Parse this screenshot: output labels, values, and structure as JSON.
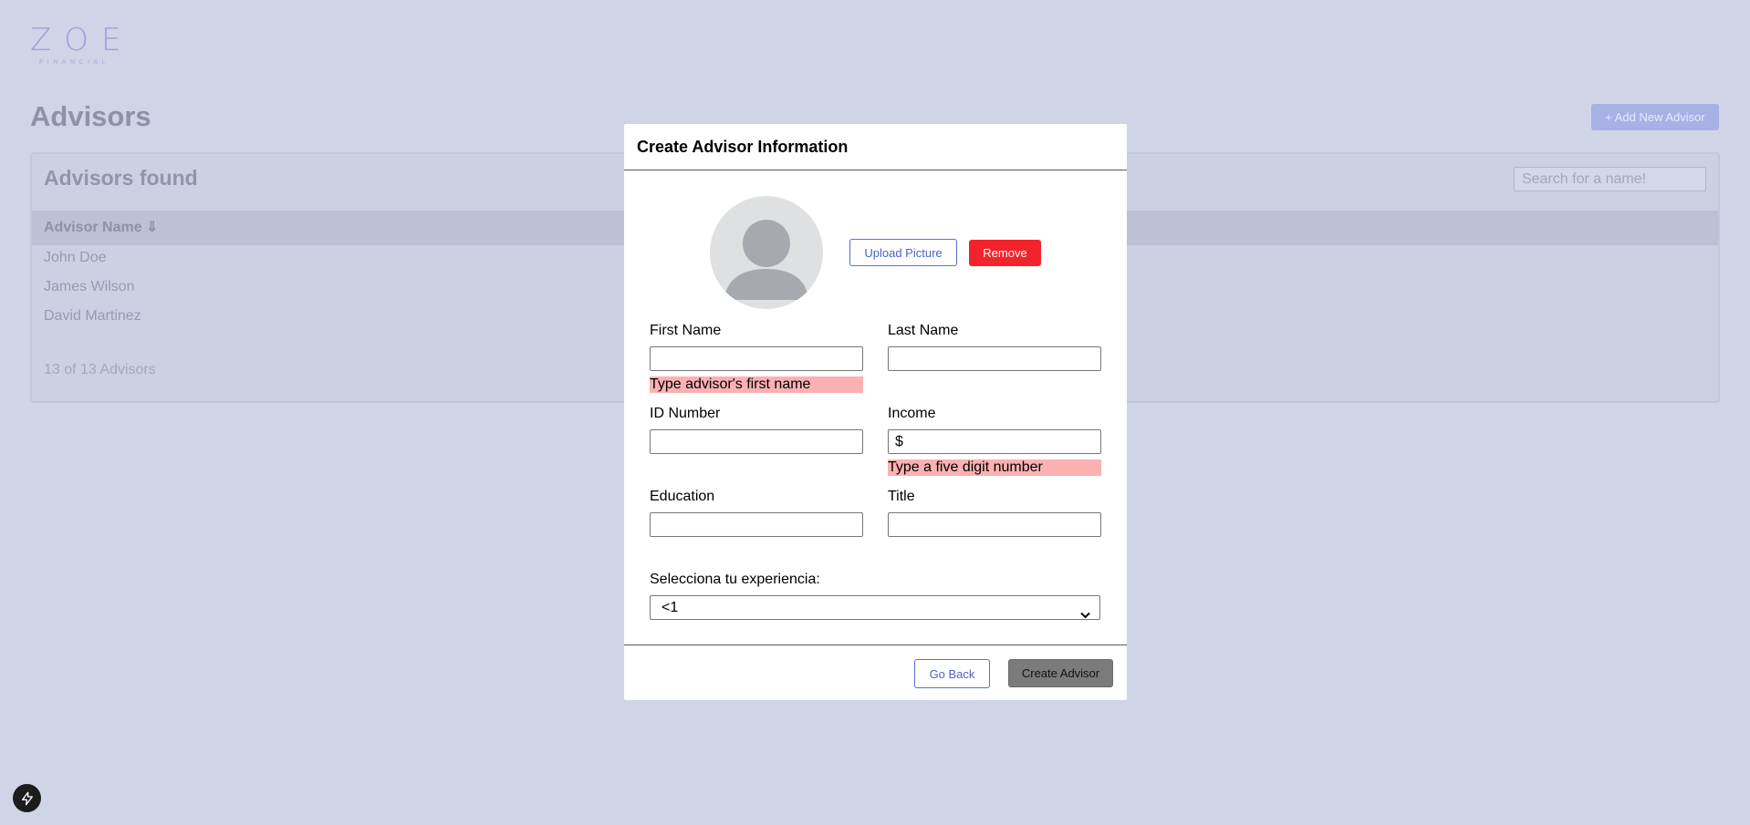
{
  "brand": {
    "logo_text": "ZOE",
    "logo_subtext": "FINANCIAL"
  },
  "page": {
    "title": "Advisors",
    "add_button_label": "+ Add New Advisor",
    "list_heading": "Advisors found",
    "search_placeholder": "Search for a name!",
    "column_header": "Advisor Name ⇓",
    "advisors": [
      "John Doe",
      "James Wilson",
      "David Martinez"
    ],
    "count_label": "13 of 13 Advisors"
  },
  "modal": {
    "title": "Create Advisor Information",
    "upload_label": "Upload Picture",
    "remove_label": "Remove",
    "first_name_label": "First Name",
    "first_name_value": "",
    "first_name_error": "Type advisor's first name",
    "last_name_label": "Last Name",
    "last_name_value": "",
    "id_label": "ID Number",
    "id_value": "",
    "income_label": "Income",
    "income_value": "$",
    "income_error": "Type a five digit number",
    "education_label": "Education",
    "education_value": "",
    "title_label": "Title",
    "title_value": "",
    "experience_label": "Selecciona tu experiencia:",
    "experience_selected": "<1",
    "go_back_label": "Go Back",
    "create_label": "Create Advisor"
  },
  "colors": {
    "overlay": "#d0d4e7",
    "accent": "#5470d8",
    "danger": "#f3232b",
    "error_bg": "#fbb1b1",
    "disabled_button": "#7b7b7b"
  },
  "icons": [
    "lightning-icon",
    "chevron-down-icon",
    "default-avatar-icon"
  ]
}
